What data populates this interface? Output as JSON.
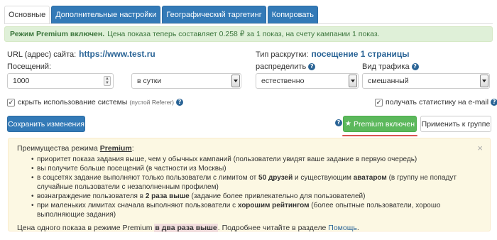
{
  "tabs": [
    {
      "label": "Основные",
      "active": true
    },
    {
      "label": "Дополнительные настройки",
      "active": false
    },
    {
      "label": "Географический таргетинг",
      "active": false
    },
    {
      "label": "Копировать",
      "active": false
    }
  ],
  "alert": {
    "title": "Режим Premium включен.",
    "text": "Цена показа теперь составляет 0.258 ₽ за 1 показ, на счету кампании 1 показ."
  },
  "url_row": {
    "label": "URL (адрес) сайта:",
    "value": "https://www.test.ru"
  },
  "promo_type": {
    "label": "Тип раскрутки:",
    "value": "посещение 1 страницы"
  },
  "visits": {
    "label": "Посещений:",
    "value": "1000",
    "period": "в сутки"
  },
  "distribute": {
    "label": "распределить",
    "value": "естественно"
  },
  "traffic": {
    "label": "Вид трафика",
    "value": "смешанный"
  },
  "checkboxes": {
    "hide_system": {
      "label": "скрыть использование системы",
      "note": "(пустой Referer)",
      "checked": true
    },
    "email_stats": {
      "label": "получать статистику на e-mail",
      "checked": true
    }
  },
  "buttons": {
    "save": "Сохранить изменения",
    "premium": "Premium включен",
    "apply_group": "Применить к группе"
  },
  "info": {
    "head_prefix": "Преимущества режима",
    "head_term": "Premium",
    "head_suffix": ":",
    "items": [
      [
        {
          "t": "приоритет показа задания выше, чем у обычных кампаний (пользователи увидят ваше задание в первую очередь)"
        }
      ],
      [
        {
          "t": "вы получите больше посещений (в частности из Москвы)"
        }
      ],
      [
        {
          "t": "в соцсетях задание выполняют только пользователи с лимитом от "
        },
        {
          "t": "50 друзей",
          "b": true
        },
        {
          "t": " и существующим "
        },
        {
          "t": "аватаром",
          "b": true
        },
        {
          "t": " (в группу не попадут случайные пользователи с незаполненным профилем)"
        }
      ],
      [
        {
          "t": "вознаграждение пользователя в "
        },
        {
          "t": "2 раза выше",
          "b": true
        },
        {
          "t": " (задание более привлекательно для пользователей)"
        }
      ],
      [
        {
          "t": "при маленьких лимитах сначала выполняют пользователи с "
        },
        {
          "t": "хорошим рейтингом",
          "b": true
        },
        {
          "t": " (более опытные пользователи, хорошо выполняющие задания)"
        }
      ]
    ],
    "foot_prefix": "Цена одного показа в режиме Premium ",
    "foot_highlight": "в два раза выше",
    "foot_middle": ". Подробнее читайте в разделе ",
    "foot_link": "Помощь",
    "foot_end": "."
  },
  "icons": {
    "help": "question-circle-icon",
    "star": "star-icon",
    "close": "close-icon"
  },
  "colors": {
    "primary": "#337ab7",
    "success": "#5cb85c",
    "alert_bg": "#dff0d8",
    "info_bg": "#fcf8e3",
    "underline": "#d9534f"
  }
}
